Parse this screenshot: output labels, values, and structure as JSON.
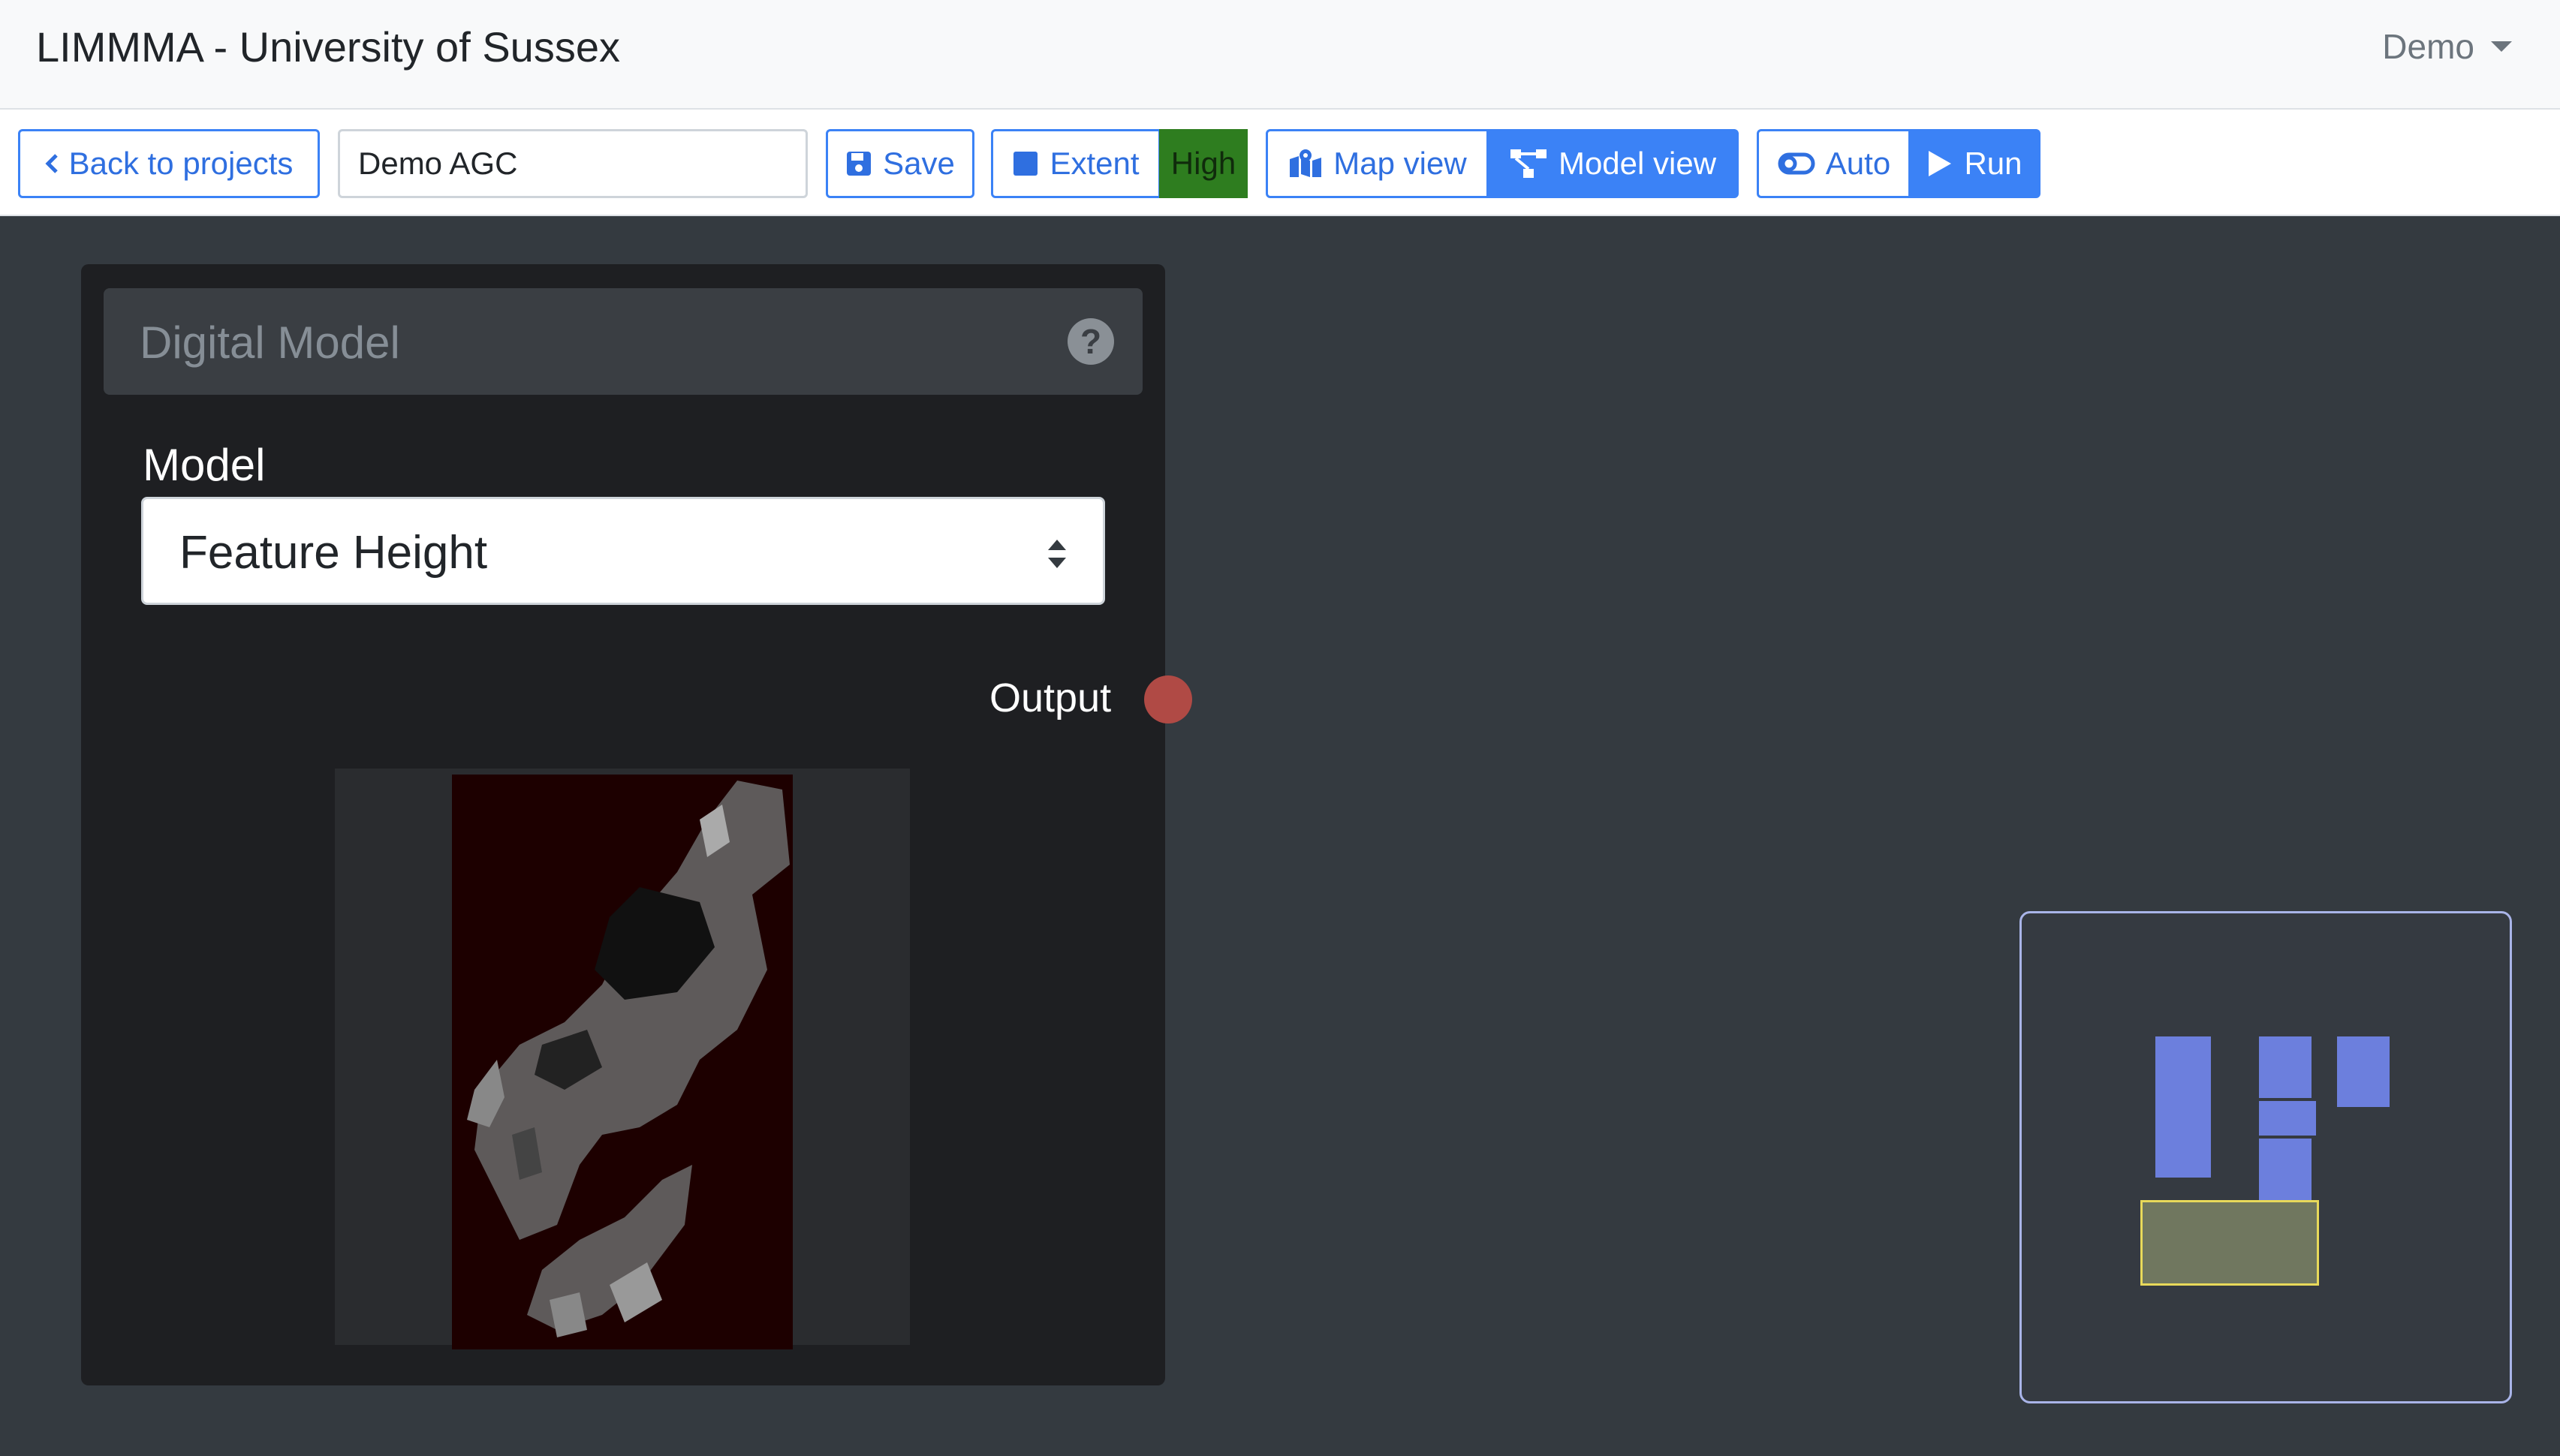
{
  "app": {
    "title": "LIMMMA - University of Sussex",
    "user_menu_label": "Demo"
  },
  "toolbar": {
    "back_label": "Back to projects",
    "project_name_value": "Demo AGC",
    "save_label": "Save",
    "extent_label": "Extent",
    "quality_badge": "High",
    "map_view_label": "Map view",
    "model_view_label": "Model view",
    "auto_label": "Auto",
    "run_label": "Run"
  },
  "node": {
    "title": "Digital Model",
    "model_label": "Model",
    "model_selected": "Feature Height",
    "output_label": "Output"
  },
  "colors": {
    "accent": "#3b82f6",
    "quality_high": "#2e7d1f",
    "output_port": "#b04a45",
    "minimap_node": "#6c7fdd",
    "minimap_viewport_border": "#e8d95a"
  },
  "icons": {
    "back": "chevron-left-icon",
    "save": "floppy-disk-icon",
    "extent": "square-icon",
    "map_view": "map-marker-icon",
    "model_view": "sitemap-icon",
    "auto": "toggle-icon",
    "run": "play-icon",
    "help": "question-circle-icon",
    "select": "sort-arrows-icon",
    "user_menu": "caret-down-icon"
  }
}
